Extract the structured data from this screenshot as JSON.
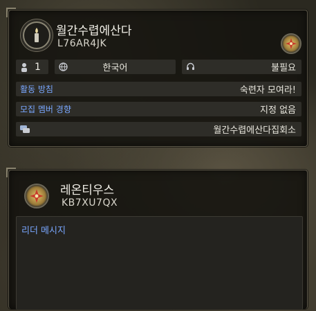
{
  "guild": {
    "name": "월간수렵에산다",
    "code": "L76AR4JK",
    "emblem_icon": "candle-emblem-icon",
    "badge_icon": "compass-emblem-icon",
    "members": "1",
    "language": "한국어",
    "voice_chat": "불필요",
    "policy_label": "활동 방침",
    "policy_value": "숙련자 모여라!",
    "tendency_label": "모집 멤버 경향",
    "tendency_value": "지정 없음",
    "hall_name": "월간수렵에산다집회소"
  },
  "leader": {
    "name": "레온티우스",
    "code": "KB7XU7QX",
    "emblem_icon": "compass-emblem-icon",
    "message_label": "리더 메시지"
  },
  "colors": {
    "label_blue": "#79a7ff",
    "row_bg": "#2e2d28",
    "panel_border": "#5d5849"
  }
}
